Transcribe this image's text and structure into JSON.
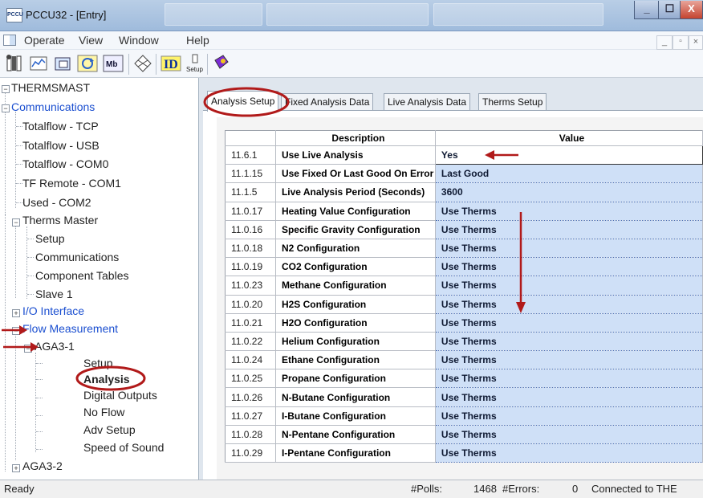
{
  "window": {
    "title": "PCCU32 - [Entry]",
    "app_icon_text": "PCCU",
    "minimize_glyph": "_",
    "maximize_glyph": "☐",
    "close_glyph": "X"
  },
  "menu": {
    "items": [
      "Operate",
      "View",
      "Window",
      "Help"
    ],
    "mdi_min": "_",
    "mdi_max": "▫",
    "mdi_close": "×"
  },
  "toolbar": {
    "icons": [
      "entry-icon",
      "entry-mode-icon",
      "collect-icon",
      "refresh-icon",
      "mb-icon",
      "network-icon",
      "id-icon",
      "setup-icon",
      "help-book-icon"
    ],
    "mb_label": "Mb",
    "id_label": "ID",
    "setup_label": "Setup"
  },
  "tree": {
    "root": "THERMSMAST",
    "communications": "Communications",
    "comm_items": [
      "Totalflow - TCP",
      "Totalflow - USB",
      "Totalflow - COM0",
      "TF Remote - COM1",
      "Used - COM2"
    ],
    "therms_master": "Therms Master",
    "therms_items": [
      "Setup",
      "Communications",
      "Component Tables",
      "Slave 1"
    ],
    "io_interface": "I/O Interface",
    "flow_measurement": "Flow Measurement",
    "aga3_1": "AGA3-1",
    "aga3_1_items": [
      "Setup",
      "Analysis",
      "Digital Outputs",
      "No Flow",
      "Adv Setup",
      "Speed of Sound"
    ],
    "aga3_2": "AGA3-2"
  },
  "tabs": [
    "Analysis Setup",
    "Fixed Analysis Data",
    "Live Analysis Data",
    "Therms Setup"
  ],
  "grid": {
    "headers": [
      "Description",
      "Value"
    ],
    "rows": [
      {
        "num": "11.6.1",
        "desc": "Use Live Analysis",
        "val": "Yes"
      },
      {
        "num": "11.1.15",
        "desc": "Use Fixed Or Last Good On Error",
        "val": "Last Good"
      },
      {
        "num": "11.1.5",
        "desc": "Live Analysis Period (Seconds)",
        "val": "3600"
      },
      {
        "num": "11.0.17",
        "desc": "Heating Value Configuration",
        "val": "Use Therms"
      },
      {
        "num": "11.0.16",
        "desc": "Specific Gravity Configuration",
        "val": "Use Therms"
      },
      {
        "num": "11.0.18",
        "desc": "N2 Configuration",
        "val": "Use Therms"
      },
      {
        "num": "11.0.19",
        "desc": "CO2 Configuration",
        "val": "Use Therms"
      },
      {
        "num": "11.0.23",
        "desc": "Methane Configuration",
        "val": "Use Therms"
      },
      {
        "num": "11.0.20",
        "desc": "H2S Configuration",
        "val": "Use Therms"
      },
      {
        "num": "11.0.21",
        "desc": "H2O Configuration",
        "val": "Use Therms"
      },
      {
        "num": "11.0.22",
        "desc": "Helium Configuration",
        "val": "Use Therms"
      },
      {
        "num": "11.0.24",
        "desc": "Ethane Configuration",
        "val": "Use Therms"
      },
      {
        "num": "11.0.25",
        "desc": "Propane Configuration",
        "val": "Use Therms"
      },
      {
        "num": "11.0.26",
        "desc": "N-Butane Configuration",
        "val": "Use Therms"
      },
      {
        "num": "11.0.27",
        "desc": "I-Butane Configuration",
        "val": "Use Therms"
      },
      {
        "num": "11.0.28",
        "desc": "N-Pentane Configuration",
        "val": "Use Therms"
      },
      {
        "num": "11.0.29",
        "desc": "I-Pentane Configuration",
        "val": "Use Therms"
      }
    ]
  },
  "status": {
    "ready": "Ready",
    "polls_label": "#Polls:",
    "polls_value": "1468",
    "errors_label": "#Errors:",
    "errors_value": "0",
    "connection": "Connected to THE"
  },
  "colors": {
    "annotation_red": "#b11a1a",
    "value_cell_blue": "#cfe0f7",
    "tree_blue": "#1b4fd0"
  }
}
